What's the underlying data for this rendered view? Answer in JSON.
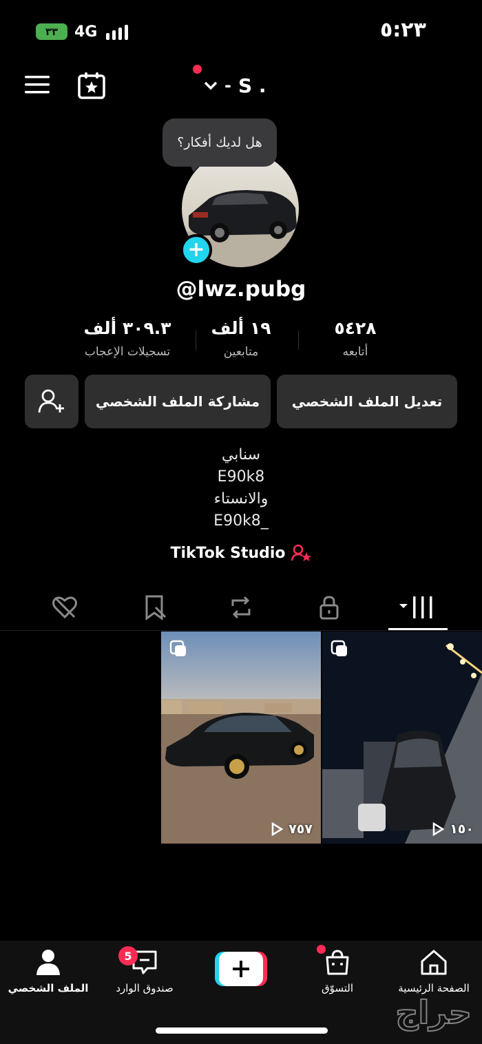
{
  "status_bar": {
    "time": "٥:٢٣",
    "battery": "٣٣",
    "network": "4G"
  },
  "header": {
    "username": "S ."
  },
  "profile": {
    "bubble_text": "هل لديك أفكار؟",
    "handle": "@lwz.pubg",
    "stats": [
      {
        "value": "٣٠٩.٣ ألف",
        "label": "تسجيلات الإعجاب"
      },
      {
        "value": "١٩ ألف",
        "label": "متابعين"
      },
      {
        "value": "٥٤٢٨",
        "label": "أتابعه"
      }
    ],
    "buttons": {
      "edit": "تعديل الملف الشخصي",
      "share": "مشاركة الملف الشخصي"
    },
    "bio_lines": [
      "سنابي",
      "E90k8",
      "والانستاء",
      "E90k8_"
    ],
    "studio_link": "TikTok Studio"
  },
  "videos": [
    {
      "views": "٧٥٧"
    },
    {
      "views": "١٥٠"
    }
  ],
  "bottom_nav": {
    "profile": "الملف الشخصي",
    "inbox": "صندوق الوارد",
    "inbox_badge": "5",
    "shop": "التسوّق",
    "home": "الصفحة الرئيسية"
  },
  "watermark": "حراج",
  "colors": {
    "accent_red": "#fe2c55",
    "accent_cyan": "#20d5ec",
    "button_bg": "#2f2f2f"
  }
}
